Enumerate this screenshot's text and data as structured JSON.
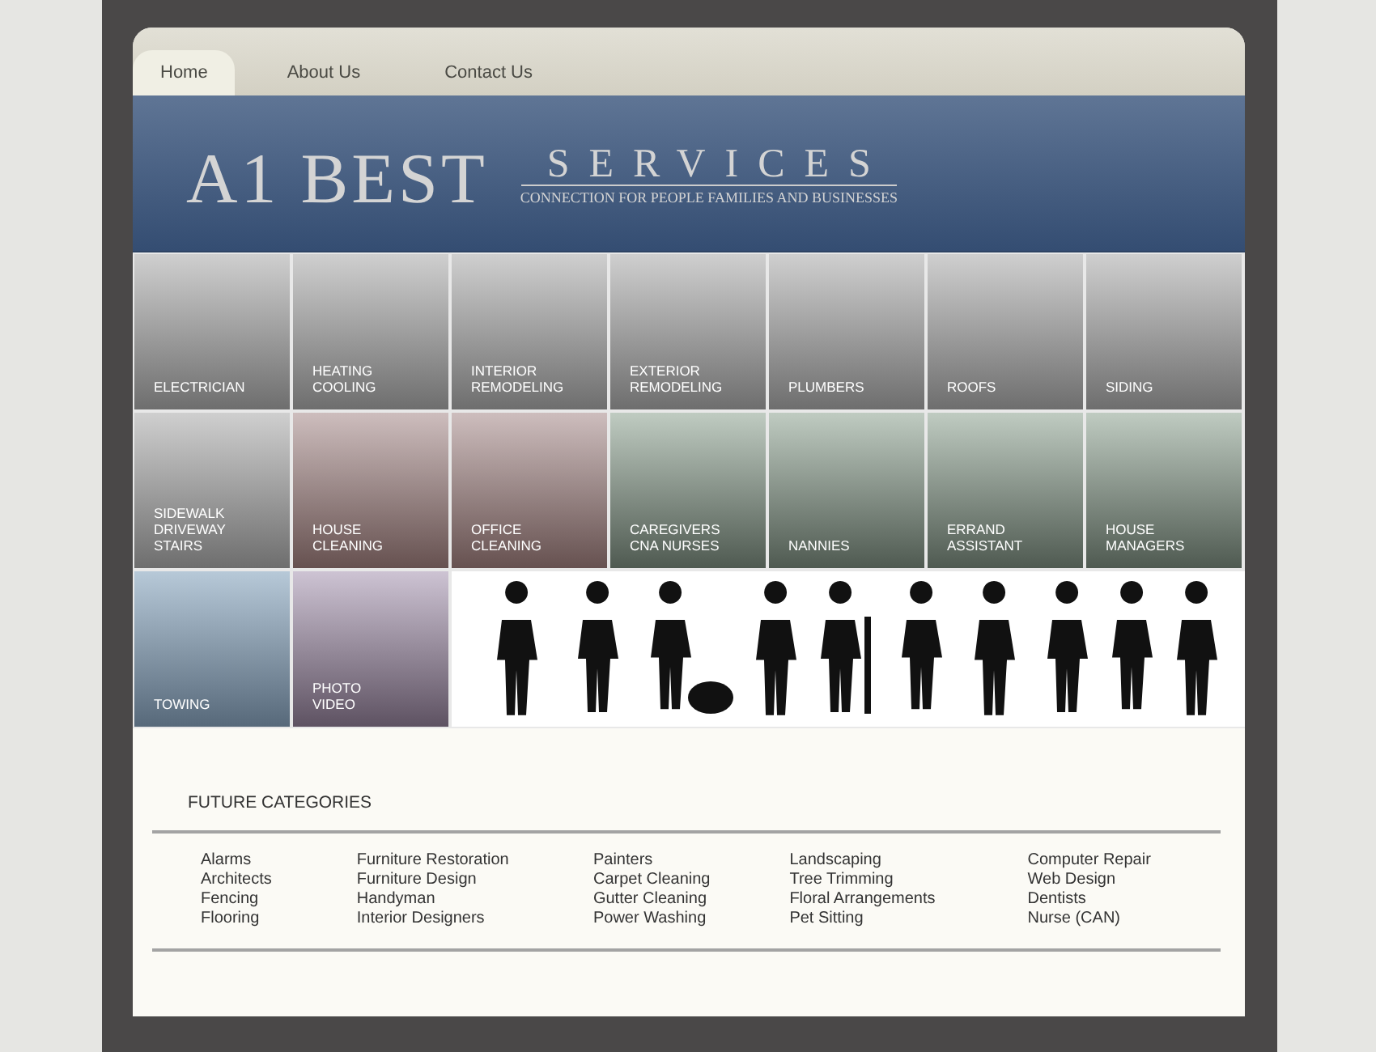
{
  "nav": {
    "tabs": [
      {
        "label": "Home",
        "selected": true
      },
      {
        "label": "About Us",
        "selected": false
      },
      {
        "label": "Contact Us",
        "selected": false
      }
    ]
  },
  "banner": {
    "title": "A1 BEST",
    "subtitle": "SERVICES",
    "tagline": "CONNECTION FOR PEOPLE FAMILIES AND BUSINESSES"
  },
  "tiles": [
    {
      "lines": [
        "ELECTRICIAN"
      ],
      "kind": "gray"
    },
    {
      "lines": [
        "HEATING",
        "COOLING"
      ],
      "kind": "gray"
    },
    {
      "lines": [
        "INTERIOR",
        "REMODELING"
      ],
      "kind": "gray"
    },
    {
      "lines": [
        "EXTERIOR",
        "REMODELING"
      ],
      "kind": "gray"
    },
    {
      "lines": [
        "PLUMBERS"
      ],
      "kind": "gray"
    },
    {
      "lines": [
        "ROOFS"
      ],
      "kind": "gray"
    },
    {
      "lines": [
        "SIDING"
      ],
      "kind": "gray"
    },
    {
      "lines": [
        "SIDEWALK",
        "DRIVEWAY",
        "STAIRS"
      ],
      "kind": "gray"
    },
    {
      "lines": [
        "HOUSE",
        "CLEANING"
      ],
      "kind": "rose"
    },
    {
      "lines": [
        "OFFICE",
        "CLEANING"
      ],
      "kind": "rose"
    },
    {
      "lines": [
        "CAREGIVERS",
        "CNA NURSES"
      ],
      "kind": "green"
    },
    {
      "lines": [
        "NANNIES"
      ],
      "kind": "green"
    },
    {
      "lines": [
        "ERRAND",
        "ASSISTANT"
      ],
      "kind": "green"
    },
    {
      "lines": [
        "HOUSE",
        "MANAGERS"
      ],
      "kind": "green"
    },
    {
      "lines": [
        "TOWING"
      ],
      "kind": "blue"
    },
    {
      "lines": [
        "PHOTO",
        "VIDEO"
      ],
      "kind": "purple"
    }
  ],
  "future": {
    "heading": "FUTURE CATEGORIES",
    "columns": [
      [
        "Alarms",
        "Architects",
        "Fencing",
        "Flooring"
      ],
      [
        "Furniture Restoration",
        "Furniture Design",
        "Handyman",
        "Interior Designers"
      ],
      [
        "Painters",
        "Carpet Cleaning",
        "Gutter Cleaning",
        "Power Washing"
      ],
      [
        "Landscaping",
        "Tree Trimming",
        "Floral Arrangements",
        "Pet Sitting"
      ],
      [
        "Computer Repair",
        "Web Design",
        "Dentists",
        "Nurse (CAN)"
      ]
    ]
  }
}
